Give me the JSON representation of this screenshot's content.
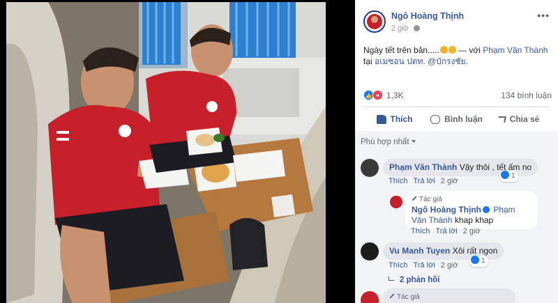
{
  "post": {
    "author": "Ngô Hoàng Thịnh",
    "time": "2 giờ",
    "more": "•••",
    "text_main": "Ngày tết trên bản.....",
    "text_with": " — với ",
    "tagged": "Phạm Văn Thành",
    "text_at": "tại ",
    "location": "อเมซอน ปตท. @บักรงชัย.",
    "reaction_count": "1,3K",
    "comment_count": "134 bình luận",
    "icons": {
      "like": "like-icon",
      "love": "love-icon",
      "globe": "globe-icon",
      "more": "more-icon"
    },
    "actions": {
      "like": "Thích",
      "comment": "Bình luận",
      "share": "Chia sẻ"
    }
  },
  "comments": {
    "sort_label": "Phù hợp nhất",
    "items": [
      {
        "name": "Phạm Văn Thành",
        "text": "Vậy thôi , tết ấm no",
        "like": "Thích",
        "reply": "Trả lời",
        "time": "2 giờ",
        "react_count": "1"
      },
      {
        "author_tag": "Tác giả",
        "name": "Ngô Hoàng Thịnh",
        "tagged": "Phạm Văn Thành",
        "text": "khap khap",
        "like": "Thích",
        "reply": "Trả lời",
        "time": "2 giờ"
      },
      {
        "name": "Vu Manh Tuyen",
        "text": "Xôi rất ngon",
        "like": "Thích",
        "reply": "Trả lời",
        "time": "2 giờ",
        "react_count": "1"
      },
      {
        "replies_label": "2 phản hồi"
      },
      {
        "author_tag": "Tác giả"
      }
    ]
  },
  "colors": {
    "brand": "#385898",
    "like_blue": "#1877f2",
    "love_red": "#f33e58",
    "jersey_red": "#c8202a"
  }
}
